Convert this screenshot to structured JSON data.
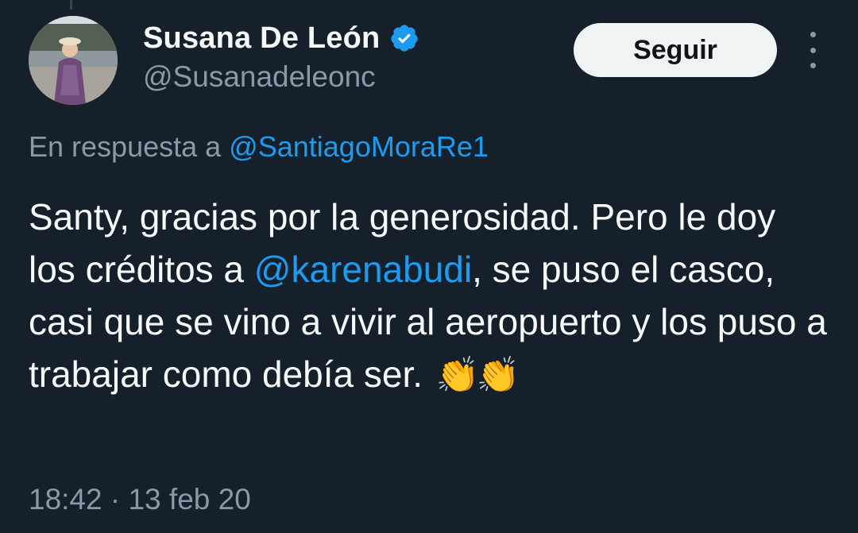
{
  "author": {
    "name": "Susana De León",
    "handle": "@Susanadeleonc",
    "verified": true,
    "avatar_icon": "profile-photo"
  },
  "actions": {
    "follow_label": "Seguir",
    "more_icon": "more-vertical-icon"
  },
  "reply": {
    "prefix": "En respuesta a",
    "to_handle": "@SantiagoMoraRe1"
  },
  "tweet": {
    "text_before_mention": "Santy, gracias por la generosidad. Pero le doy los créditos a ",
    "mention": "@karenabudi",
    "text_after_mention": ", se puso el casco, casi que se vino a vivir al aeropuerto y los puso a trabajar como debía ser.",
    "emoji": "👏👏"
  },
  "meta": {
    "time": "18:42",
    "separator": "·",
    "date": "13 feb 20"
  },
  "colors": {
    "background": "#15202b",
    "text_primary": "#f7f9f9",
    "text_secondary": "#8b98a5",
    "accent": "#1d9bf0",
    "button_bg": "#eff3f4"
  }
}
